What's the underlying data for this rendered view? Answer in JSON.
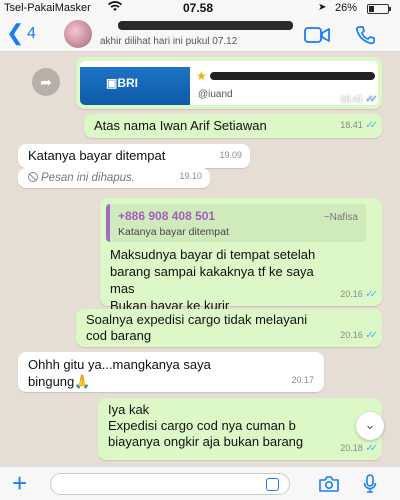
{
  "status_bar": {
    "carrier": "Tsel-PakaiMasker",
    "time": "07.58",
    "battery": "26%"
  },
  "header": {
    "back_count": "4",
    "last_seen": "akhir dilihat hari ini pukul 07.12"
  },
  "messages": [
    {
      "id": "link",
      "direction": "outgoing",
      "preview_brand": "BRI",
      "preview_handle": "@iuand",
      "time": "18.41",
      "status": "read"
    },
    {
      "id": "m1",
      "direction": "outgoing",
      "text": "Atas nama Iwan Arif Setiawan",
      "time": "18.41",
      "status": "read"
    },
    {
      "id": "m2",
      "direction": "incoming",
      "text": "Katanya bayar ditempat",
      "time": "19.09"
    },
    {
      "id": "m3",
      "direction": "incoming",
      "deleted": true,
      "text": "Pesan ini dihapus.",
      "time": "19.10"
    },
    {
      "id": "m4",
      "direction": "outgoing",
      "reply_to": {
        "name": "+886 908 408 501",
        "alias": "~Nafisa",
        "text": "Katanya bayar ditempat"
      },
      "lines": [
        "Maksudnya bayar di tempat setelah",
        "barang sampai kakaknya tf ke saya",
        "mas",
        "Bukan bayar ke kurir"
      ],
      "time": "20.16",
      "status": "read"
    },
    {
      "id": "m5",
      "direction": "outgoing",
      "lines": [
        "Soalnya expedisi cargo tidak melayani",
        "cod barang"
      ],
      "time": "20.16",
      "status": "read"
    },
    {
      "id": "m6",
      "direction": "incoming",
      "lines": [
        "Ohhh gitu ya...mangkanya saya",
        "bingung🙏"
      ],
      "time": "20.17"
    },
    {
      "id": "m7",
      "direction": "outgoing",
      "lines": [
        "Iya kak",
        "Expedisi cargo cod nya cuman b",
        "biayanya ongkir aja  bukan barang"
      ],
      "time": "20.18",
      "status": "read"
    }
  ],
  "icons": {
    "back": "chevron-left-icon",
    "video": "video-call-icon",
    "call": "phone-call-icon",
    "forward": "share-forward-icon",
    "scroll": "chevron-down-icon",
    "attach": "plus-icon",
    "sticker": "sticker-icon",
    "camera": "camera-icon",
    "mic": "microphone-icon"
  },
  "colors": {
    "accent": "#1a7ef2",
    "outgoing_bubble": "#dcf8c6",
    "incoming_bubble": "#ffffff",
    "read_ticks": "#4fb6ec",
    "chat_background": "#e6ddd4"
  }
}
